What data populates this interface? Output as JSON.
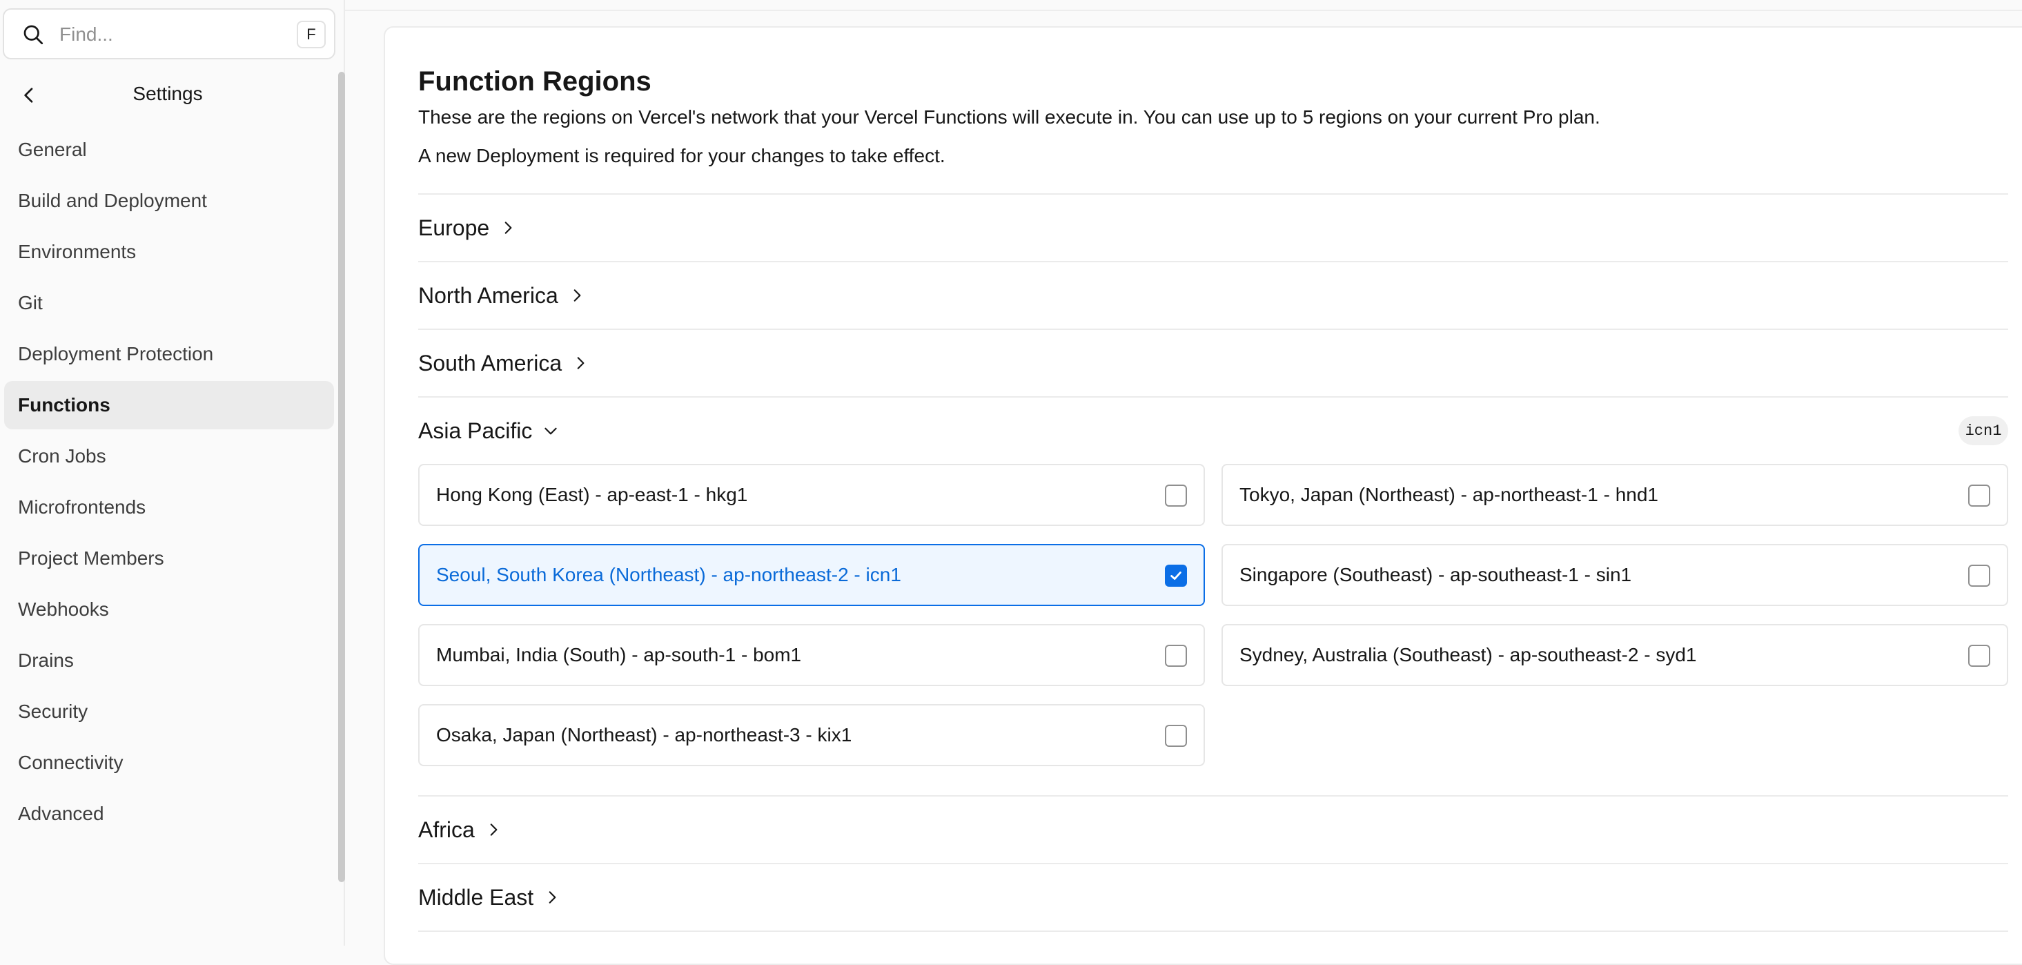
{
  "search": {
    "placeholder": "Find...",
    "shortcut": "F"
  },
  "sidebar": {
    "title": "Settings",
    "items": [
      {
        "label": "General"
      },
      {
        "label": "Build and Deployment"
      },
      {
        "label": "Environments"
      },
      {
        "label": "Git"
      },
      {
        "label": "Deployment Protection"
      },
      {
        "label": "Functions",
        "active": true
      },
      {
        "label": "Cron Jobs"
      },
      {
        "label": "Microfrontends"
      },
      {
        "label": "Project Members"
      },
      {
        "label": "Webhooks"
      },
      {
        "label": "Drains"
      },
      {
        "label": "Security"
      },
      {
        "label": "Connectivity"
      },
      {
        "label": "Advanced"
      }
    ]
  },
  "main": {
    "title": "Function Regions",
    "description": "These are the regions on Vercel's network that your Vercel Functions will execute in. You can use up to 5 regions on your current Pro plan.",
    "note": "A new Deployment is required for your changes to take effect.",
    "groups": {
      "europe": {
        "label": "Europe",
        "expanded": false
      },
      "north_america": {
        "label": "North America",
        "expanded": false
      },
      "south_america": {
        "label": "South America",
        "expanded": false
      },
      "asia_pacific": {
        "label": "Asia Pacific",
        "expanded": true,
        "selected_badge": "icn1"
      },
      "africa": {
        "label": "Africa",
        "expanded": false
      },
      "middle_east": {
        "label": "Middle East",
        "expanded": false
      }
    },
    "asia_pacific_regions": [
      {
        "label": "Hong Kong (East) - ap-east-1 - hkg1",
        "checked": false
      },
      {
        "label": "Tokyo, Japan (Northeast) - ap-northeast-1 - hnd1",
        "checked": false
      },
      {
        "label": "Seoul, South Korea (Northeast) - ap-northeast-2 - icn1",
        "checked": true
      },
      {
        "label": "Singapore (Southeast) - ap-southeast-1 - sin1",
        "checked": false
      },
      {
        "label": "Mumbai, India (South) - ap-south-1 - bom1",
        "checked": false
      },
      {
        "label": "Sydney, Australia (Southeast) - ap-southeast-2 - syd1",
        "checked": false
      },
      {
        "label": "Osaka, Japan (Northeast) - ap-northeast-3 - kix1",
        "checked": false
      }
    ]
  },
  "colors": {
    "accent": "#0b6ee6",
    "selected_bg": "#eef6ff",
    "active_nav_bg": "#ebebeb"
  }
}
